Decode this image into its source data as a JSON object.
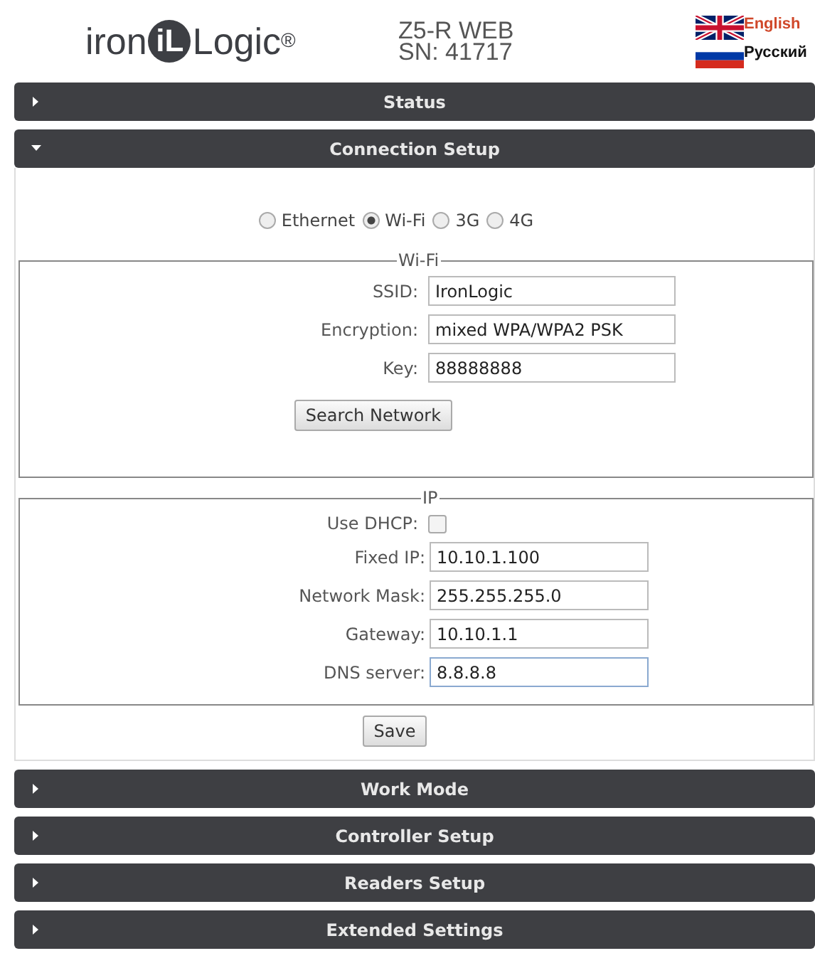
{
  "header": {
    "logo": {
      "prefix": "iron",
      "mark": "iL",
      "suffix": "Logic",
      "registered": "®"
    },
    "model": "Z5-R WEB",
    "serial": "SN: 41717",
    "languages": [
      {
        "label": "English",
        "kind": "uk",
        "selected": true
      },
      {
        "label": "Русский",
        "kind": "ru",
        "selected": false
      }
    ]
  },
  "sections": [
    {
      "title": "Status",
      "expanded": false
    },
    {
      "title": "Connection Setup",
      "expanded": true
    },
    {
      "title": "Work Mode",
      "expanded": false
    },
    {
      "title": "Controller Setup",
      "expanded": false
    },
    {
      "title": "Readers Setup",
      "expanded": false
    },
    {
      "title": "Extended Settings",
      "expanded": false
    }
  ],
  "connection": {
    "modes": [
      {
        "label": "Ethernet",
        "selected": false
      },
      {
        "label": "Wi-Fi",
        "selected": true
      },
      {
        "label": "3G",
        "selected": false
      },
      {
        "label": "4G",
        "selected": false
      }
    ],
    "wifi": {
      "legend": "Wi-Fi",
      "fields": [
        {
          "label": "SSID:",
          "value": "IronLogic"
        },
        {
          "label": "Encryption:",
          "value": "mixed WPA/WPA2 PSK"
        },
        {
          "label": "Key:",
          "value": "88888888"
        }
      ],
      "button": "Search Network"
    },
    "ip": {
      "legend": "IP",
      "fields": [
        {
          "kind": "checkbox",
          "label": "Use DHCP:",
          "checked": false
        },
        {
          "kind": "text",
          "label": "Fixed IP:",
          "value": "10.10.1.100",
          "focused": false
        },
        {
          "kind": "text",
          "label": "Network Mask:",
          "value": "255.255.255.0",
          "focused": false
        },
        {
          "kind": "text",
          "label": "Gateway:",
          "value": "10.10.1.1",
          "focused": false
        },
        {
          "kind": "text",
          "label": "DNS server:",
          "value": "8.8.8.8",
          "focused": true
        }
      ]
    },
    "save": "Save"
  }
}
